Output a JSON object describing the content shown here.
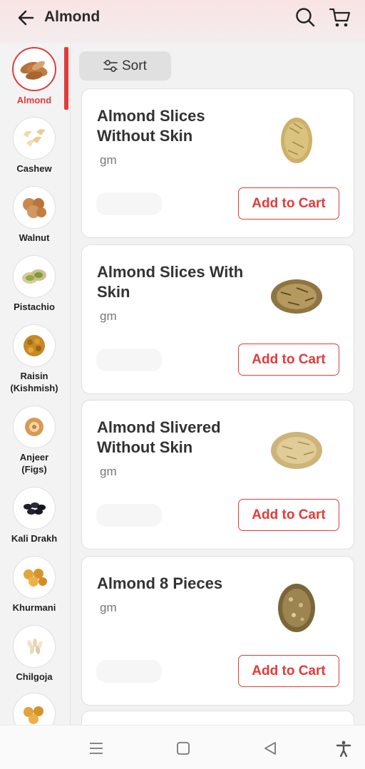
{
  "header": {
    "title": "Almond",
    "back_icon": "arrow-left-icon",
    "search_icon": "search-icon",
    "cart_icon": "cart-icon"
  },
  "sidebar": {
    "accent_color": "#e43a3a",
    "items": [
      {
        "label": "Almond",
        "active": true,
        "icon": "almond-image"
      },
      {
        "label": "Cashew",
        "active": false,
        "icon": "cashew-image"
      },
      {
        "label": "Walnut",
        "active": false,
        "icon": "walnut-image"
      },
      {
        "label": "Pistachio",
        "active": false,
        "icon": "pistachio-image"
      },
      {
        "label": "Raisin\n(Kishmish)",
        "active": false,
        "icon": "raisin-image"
      },
      {
        "label": "Anjeer\n(Figs)",
        "active": false,
        "icon": "fig-image"
      },
      {
        "label": "Kali Drakh",
        "active": false,
        "icon": "black-raisin-image"
      },
      {
        "label": "Khurmani",
        "active": false,
        "icon": "apricot-image"
      },
      {
        "label": "Chilgoja",
        "active": false,
        "icon": "pine-nut-image"
      }
    ]
  },
  "sort": {
    "label": "Sort",
    "icon": "sliders-icon"
  },
  "products": [
    {
      "name": "Almond Slices Without Skin",
      "unit": "gm",
      "button": "Add to Cart"
    },
    {
      "name": "Almond Slices With Skin",
      "unit": "gm",
      "button": "Add to Cart"
    },
    {
      "name": "Almond Slivered Without Skin",
      "unit": "gm",
      "button": "Add to Cart"
    },
    {
      "name": "Almond 8 Pieces",
      "unit": "gm",
      "button": "Add to Cart"
    }
  ],
  "navbar": {
    "icons": [
      "menu-icon",
      "home-square-icon",
      "back-triangle-icon",
      "accessibility-icon"
    ]
  }
}
